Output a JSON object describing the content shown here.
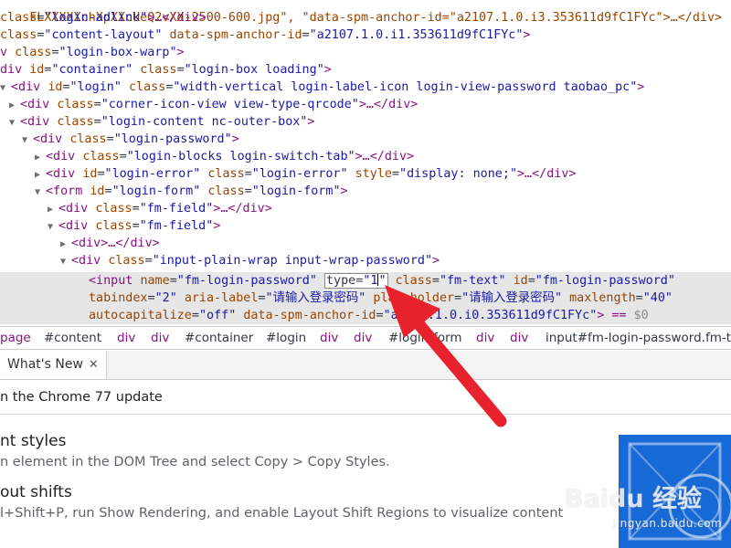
{
  "dom_tree": {
    "line1": {
      "text": "FLXXXXXchXpXXcUeQ2vXX-2500-600.jpg\", \"data-spm-anchor-id=\"a2107.1.0.i3.353611d9fC1FYc\">…</div>"
    },
    "line2": {
      "attr": "class",
      "val": "login-adlink",
      "rest": ">…</div>"
    },
    "line3": {
      "attr": "class",
      "val": "content-layout",
      "attr2": "data-spm-anchor-id",
      "val2": "a2107.1.0.i1.353611d9fC1FYc",
      "rest": ">"
    },
    "line4": {
      "tag": "v",
      "attr": "class",
      "val": "login-box-warp",
      "rest": ">"
    },
    "line5": {
      "tag": "div",
      "attr": "id",
      "val": "container",
      "attr2": "class",
      "val2": "login-box loading",
      "rest": ">"
    },
    "line6": {
      "tag": "<div",
      "attr": "id",
      "val": "login",
      "attr2": "class",
      "val2": "width-vertical login-label-icon login-view-password taobao_pc",
      "rest": ">"
    },
    "line7": {
      "tag": "<div",
      "attr": "class",
      "val": "corner-icon-view view-type-qrcode",
      "rest": ">…</div>"
    },
    "line8": {
      "tag": "<div",
      "attr": "class",
      "val": "login-content nc-outer-box",
      "rest": ">"
    },
    "line9": {
      "tag": "<div",
      "attr": "class",
      "val": "login-password",
      "rest": ">"
    },
    "line10": {
      "tag": "<div",
      "attr": "class",
      "val": "login-blocks login-switch-tab",
      "rest": ">…</div>"
    },
    "line11": {
      "tag": "<div",
      "attr": "id",
      "val": "login-error",
      "attr2": "class",
      "val2": "login-error",
      "attr3": "style",
      "val3": "display: none;",
      "rest": ">…</div>"
    },
    "line12": {
      "tag": "<form",
      "attr": "id",
      "val": "login-form",
      "attr2": "class",
      "val2": "login-form",
      "rest": ">"
    },
    "line13": {
      "tag": "<div",
      "attr": "class",
      "val": "fm-field",
      "rest": ">…</div>"
    },
    "line14": {
      "tag": "<div",
      "attr": "class",
      "val": "fm-field",
      "rest": ">"
    },
    "line15": {
      "tag": "<div",
      "rest": ">…</div>"
    },
    "line16": {
      "tag": "<div",
      "attr": "class",
      "val": "input-plain-wrap input-wrap-password",
      "rest": ">"
    },
    "sel1": {
      "tag": "<input",
      "attr": "name",
      "val": "fm-login-password",
      "edit_attr": "type",
      "edit_val": "1",
      "attr2": "class",
      "val2": "fm-text",
      "attr3": "id",
      "val3": "fm-login-password"
    },
    "sel2": {
      "attr": "tabindex",
      "val": "2",
      "attr2": "aria-label",
      "val2": "请输入登录密码",
      "attr3": "placeholder",
      "val3": "请输入登录密码",
      "attr4": "maxlength",
      "val4": "40"
    },
    "sel3": {
      "attr": "autocapitalize",
      "val": "off",
      "attr2": "data-spm-anchor-id",
      "val2": "a2107.1.0.i0.353611d9fC1FYc",
      "rest": "> == ",
      "dollar": "$0"
    }
  },
  "breadcrumb": [
    {
      "label": "page",
      "kind": "tag"
    },
    {
      "label": "#content",
      "kind": "id"
    },
    {
      "label": "div",
      "kind": "tag"
    },
    {
      "label": "div",
      "kind": "tag"
    },
    {
      "label": "#container",
      "kind": "id"
    },
    {
      "label": "#login",
      "kind": "id"
    },
    {
      "label": "div",
      "kind": "tag"
    },
    {
      "label": "div",
      "kind": "tag"
    },
    {
      "label": "#login-form",
      "kind": "id"
    },
    {
      "label": "div",
      "kind": "tag"
    },
    {
      "label": "div",
      "kind": "tag"
    },
    {
      "label": "input#fm-login-password.fm-te",
      "kind": "selected"
    }
  ],
  "drawer": {
    "tab_label": "What's New",
    "close_glyph": "✕"
  },
  "whats_new": {
    "update_line": "n the Chrome 77 update",
    "feature1_title": "nt styles",
    "feature1_desc": "n element in the DOM Tree and select Copy > Copy Styles.",
    "feature2_title": "out shifts",
    "feature2_desc": "l+Shift+P, run Show Rendering, and enable Layout Shift Regions to visualize content"
  },
  "watermark": {
    "logo": "Baidu 经验",
    "url": "jingyan.baidu.com"
  },
  "colors": {
    "tag": "#881280",
    "attr_name": "#994500",
    "attr_value": "#1a1aa6",
    "selected_row": "#e6e6e6",
    "arrow": "#e8222d",
    "thumbnail": "#1769d6"
  }
}
